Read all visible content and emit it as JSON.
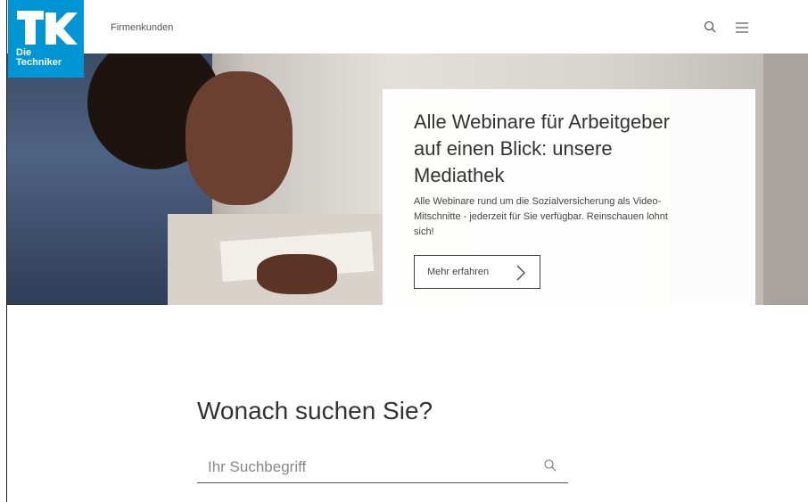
{
  "brand": {
    "logo_line1": "Die",
    "logo_line2": "Techniker",
    "color": "#0096d6"
  },
  "header": {
    "nav_link": "Firmenkunden",
    "icons": [
      "search-icon",
      "menu-icon"
    ]
  },
  "hero": {
    "title": "Alle Webinare für Arbeitgeber auf einen Blick: unsere Mediathek",
    "text": "Alle Webinare rund um die Sozialversicherung als Video-Mitschnitte - jederzeit für Sie verfügbar. Reinschauen lohnt sich!",
    "cta_label": "Mehr erfahren",
    "cta_icon": "chevron-right-icon"
  },
  "search": {
    "heading": "Wonach suchen Sie?",
    "placeholder": "Ihr Suchbegriff",
    "value": "",
    "icon": "search-icon"
  }
}
